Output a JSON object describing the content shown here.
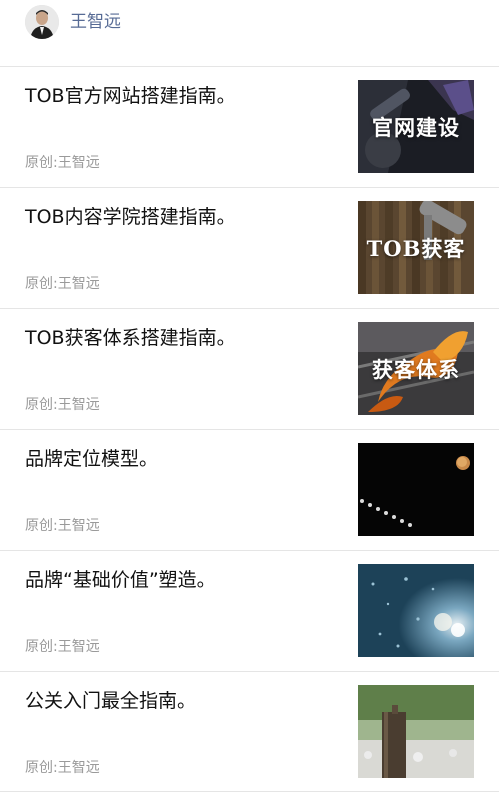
{
  "author": {
    "name": "王智远"
  },
  "articles": [
    {
      "title": "TOB官方网站搭建指南。",
      "meta": "原创:王智远",
      "thumb_caption": "官网建设"
    },
    {
      "title": "TOB内容学院搭建指南。",
      "meta": "原创:王智远",
      "thumb_caption": "TOB获客"
    },
    {
      "title": "TOB获客体系搭建指南。",
      "meta": "原创:王智远",
      "thumb_caption": "获客体系"
    },
    {
      "title": "品牌定位模型。",
      "meta": "原创:王智远",
      "thumb_caption": ""
    },
    {
      "title": "品牌“基础价值”塑造。",
      "meta": "原创:王智远",
      "thumb_caption": ""
    },
    {
      "title": "公关入门最全指南。",
      "meta": "原创:王智远",
      "thumb_caption": ""
    }
  ],
  "colors": {
    "author_link": "#576b95",
    "title_text": "#111111",
    "meta_text": "#9a9a9a",
    "divider": "#e5e5e5"
  }
}
